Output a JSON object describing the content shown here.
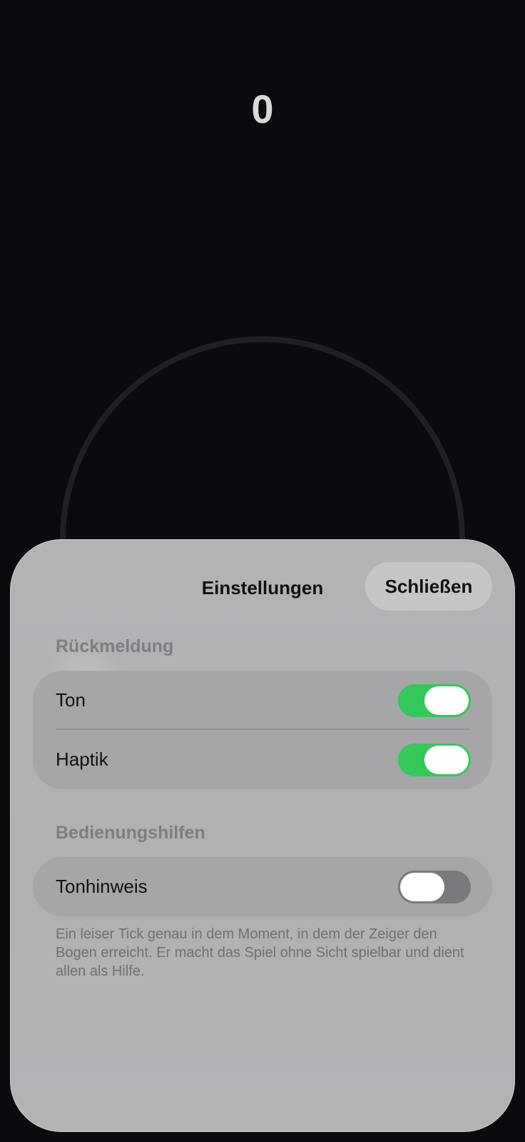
{
  "game": {
    "score": "0"
  },
  "settings": {
    "title": "Einstellungen",
    "close_label": "Schließen",
    "sections": {
      "feedback": {
        "header": "Rückmeldung",
        "rows": [
          {
            "label": "Ton",
            "enabled": true
          },
          {
            "label": "Haptik",
            "enabled": true
          }
        ]
      },
      "accessibility": {
        "header": "Bedienungshilfen",
        "rows": [
          {
            "label": "Tonhinweis",
            "enabled": false
          }
        ],
        "footnote": "Ein leiser Tick genau in dem Moment, in dem der Zeiger den Bogen erreicht. Er macht das Spiel ohne Sicht spielbar und dient allen als Hilfe."
      }
    }
  },
  "colors": {
    "background": "#0a0b0e",
    "toggle_on": "#34c759",
    "toggle_off": "#7a7a7e",
    "sheet": "#b3b3b6"
  }
}
